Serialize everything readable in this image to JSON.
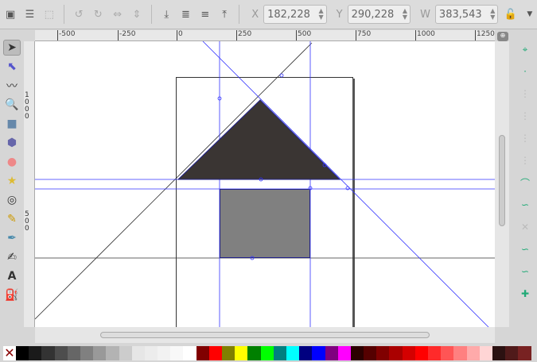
{
  "toolbar": {
    "x_label": "X",
    "x_value": "182,228",
    "y_label": "Y",
    "y_value": "290,228",
    "w_label": "W",
    "w_value": "383,543"
  },
  "ruler": {
    "h_ticks": [
      "-500",
      "-250",
      "0",
      "250",
      "500",
      "750",
      "1000",
      "1250"
    ],
    "v_ticks": [
      "1000",
      "500"
    ]
  },
  "tools": [
    "selector-icon",
    "node-editor-icon",
    "tweak-icon",
    "zoom-icon",
    "rectangle-icon",
    "3d-box-icon",
    "ellipse-icon",
    "star-icon",
    "spiral-icon",
    "pencil-icon",
    "pen-icon",
    "calligraphy-icon",
    "text-icon",
    "spray-icon"
  ],
  "snap_tools": [
    "snap-toggle-icon",
    "snap-bbox-icon",
    "snap-bbox-edge-icon",
    "snap-bbox-corner-icon",
    "snap-bbox-midpoint-icon",
    "snap-bbox-center-icon",
    "snap-nodes-icon",
    "snap-path-icon",
    "snap-intersection-icon",
    "snap-cusp-icon",
    "snap-smooth-icon",
    "snap-midpoint-icon"
  ],
  "palette": [
    "#000000",
    "#1a1a1a",
    "#333333",
    "#4d4d4d",
    "#666666",
    "#808080",
    "#999999",
    "#b3b3b3",
    "#cccccc",
    "#e6e6e6",
    "#ececec",
    "#f2f2f2",
    "#f8f8f8",
    "#ffffff",
    "#800000",
    "#ff0000",
    "#808000",
    "#ffff00",
    "#008000",
    "#00ff00",
    "#008080",
    "#00ffff",
    "#000080",
    "#0000ff",
    "#800080",
    "#ff00ff",
    "#2b0000",
    "#550000",
    "#800000",
    "#aa0000",
    "#d40000",
    "#ff0000",
    "#ff2a2a",
    "#ff5555",
    "#ff8080",
    "#ffaaaa",
    "#ffd5d5",
    "#2b1111",
    "#501a1a",
    "#782222"
  ],
  "colors": {
    "guide": "#3333ff",
    "triangle_fill": "#3a3533",
    "square_fill": "#808080"
  }
}
